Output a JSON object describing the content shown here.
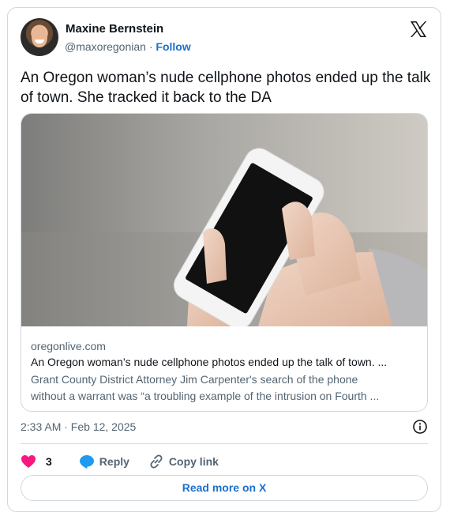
{
  "author": {
    "name": "Maxine Bernstein",
    "handle": "@maxoregonian",
    "separator": "·",
    "follow_label": "Follow"
  },
  "tweet": {
    "text": "An Oregon woman’s nude cellphone photos ended up the talk of town. She tracked it back to the DA"
  },
  "link_card": {
    "domain": "oregonlive.com",
    "title": "An Oregon woman’s nude cellphone photos ended up the talk of town. ...",
    "description_line1": "Grant County District Attorney Jim Carpenter's search of the phone",
    "description_line2": "without a warrant was “a troubling example of the intrusion on Fourth ..."
  },
  "timestamp": "2:33 AM · Feb 12, 2025",
  "actions": {
    "like_count": "3",
    "reply_label": "Reply",
    "copy_link_label": "Copy link"
  },
  "read_more_label": "Read more on X",
  "colors": {
    "like": "#f91880",
    "reply": "#1d9bf0",
    "link": "#1d6fc9",
    "border": "#cfd9de",
    "secondary_text": "#536471"
  },
  "icons": [
    "x-logo-icon",
    "info-icon",
    "heart-icon",
    "reply-bubble-icon",
    "link-icon"
  ]
}
